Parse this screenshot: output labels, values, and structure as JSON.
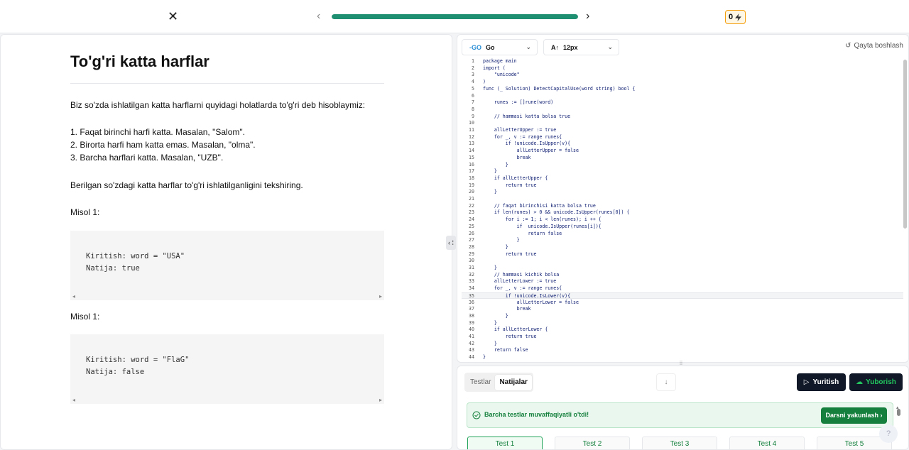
{
  "topbar": {
    "close_icon": "close-icon",
    "progress_percent": 100,
    "energy_count": "0",
    "colors": {
      "progress": "#1f8f72",
      "energy_border": "#f59e0b"
    }
  },
  "problem": {
    "title": "To'g'ri katta harflar",
    "intro": "Biz so'zda ishlatilgan katta harflarni quyidagi holatlarda to'g'ri deb hisoblaymiz:",
    "rules": [
      "1. Faqat birinchi harfi katta. Masalan, \"Salom\".",
      "2. Birorta harfi ham katta emas. Masalan, \"olma\".",
      "3. Barcha harflari katta. Masalan, \"UZB\"."
    ],
    "task": "Berilgan so'zdagi katta harflar to'g'ri ishlatilganligini tekshiring.",
    "examples": [
      {
        "heading": "Misol 1:",
        "input": "Kiritish: word = \"USA\"",
        "output": "Natija: true"
      },
      {
        "heading": "Misol 1:",
        "input": "Kiritish: word = \"FlaG\"",
        "output": "Natija: false"
      }
    ]
  },
  "editor": {
    "language": "Go",
    "font_size": "12px",
    "reset_label": "Qayta boshlash",
    "highlighted_line": 35,
    "lines": [
      "package main",
      "import (",
      "    \"unicode\"",
      ")",
      "func (_ Solution) DetectCapitalUse(word string) bool {",
      "",
      "    runes := []rune(word)",
      "",
      "    // hammasi katta bolsa true",
      "",
      "    allLetterUpper := true",
      "    for _, v := range runes{",
      "        if !unicode.IsUpper(v){",
      "            allLetterUpper = false",
      "            break",
      "        }",
      "    }",
      "    if allLetterUpper {",
      "        return true",
      "    }",
      "",
      "    // faqat birinchisi katta bolsa true",
      "    if len(runes) > 0 && unicode.IsUpper(runes[0]) {",
      "        for i := 1; i < len(runes); i ++ {",
      "            if  unicode.IsUpper(runes[i]){",
      "                return false",
      "            }",
      "        }",
      "        return true",
      "",
      "    }",
      "    // hammasi kichik bolsa",
      "    allLetterLower := true",
      "    for _, v := range runes{",
      "        if !unicode.IsLower(v){",
      "            allLetterLower = false",
      "            break",
      "        }",
      "    }",
      "    if allLetterLower {",
      "        return true",
      "    }",
      "    return false",
      "}"
    ]
  },
  "results": {
    "tabs": [
      "Testlar",
      "Natijalar"
    ],
    "active_tab": "Natijalar",
    "run_label": "Yuritish",
    "submit_label": "Yuborish",
    "success_message": "Barcha testlar muvaffaqiyatli o'tdi!",
    "finish_label": "Darsni yakunlash",
    "tests": [
      "Test 1",
      "Test 2",
      "Test 3",
      "Test 4",
      "Test 5"
    ],
    "help_label": "?"
  }
}
